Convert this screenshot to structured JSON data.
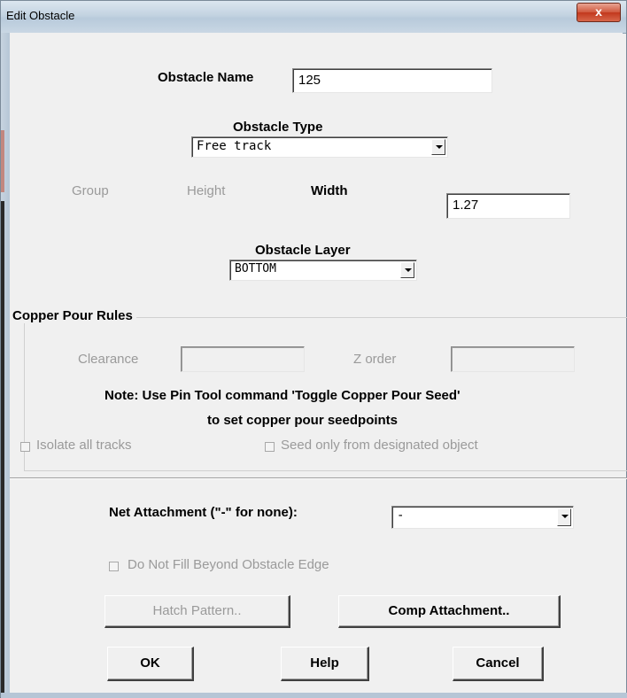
{
  "window": {
    "title": "Edit Obstacle",
    "close_glyph": "x"
  },
  "obstacle_name": {
    "label": "Obstacle Name",
    "value": "125"
  },
  "obstacle_type": {
    "label": "Obstacle Type",
    "selected": "Free track"
  },
  "dimensions": {
    "group_label": "Group",
    "height_label": "Height",
    "width_label": "Width",
    "width_value": "1.27"
  },
  "obstacle_layer": {
    "label": "Obstacle Layer",
    "selected": "BOTTOM"
  },
  "copper_pour": {
    "title": "Copper Pour Rules",
    "clearance_label": "Clearance",
    "z_order_label": "Z order",
    "note_line1": "Note: Use Pin Tool command 'Toggle Copper Pour Seed'",
    "note_line2": "to set copper pour seedpoints",
    "isolate_label": "Isolate all tracks",
    "seed_label": "Seed only from designated object"
  },
  "net_attachment": {
    "label": "Net Attachment (\"-\" for none):",
    "selected": "-"
  },
  "fill_beyond": {
    "label": "Do Not Fill Beyond Obstacle Edge"
  },
  "buttons": {
    "hatch": "Hatch Pattern..",
    "comp": "Comp Attachment..",
    "ok": "OK",
    "help": "Help",
    "cancel": "Cancel"
  },
  "colors": {
    "dialog_bg": "#f0f0f0",
    "disabled_text": "#9a9a9a",
    "close_button": "#c2381d"
  }
}
